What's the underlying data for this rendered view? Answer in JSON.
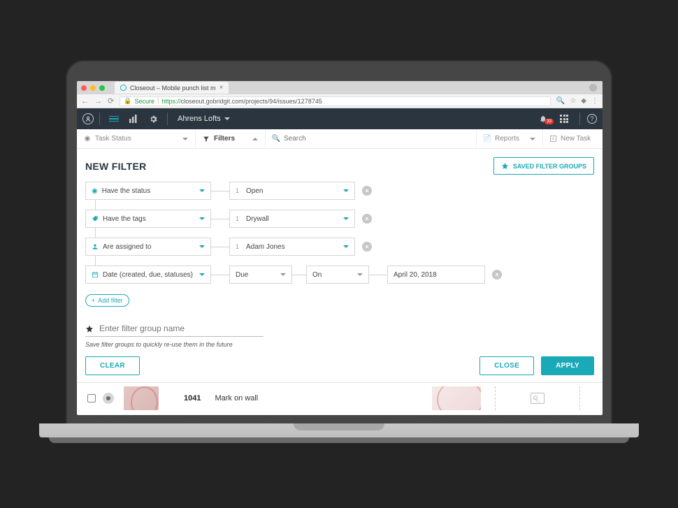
{
  "browser": {
    "tab_title": "Closeout – Mobile punch list m",
    "secure_label": "Secure",
    "url_proto": "https://",
    "url_rest": "closeout.gobridgit.com/projects/94/issues/1278745"
  },
  "header": {
    "project_name": "Ahrens Lofts",
    "notif_count": "33"
  },
  "toolbar": {
    "task_status": "Task Status",
    "filters": "Filters",
    "search_placeholder": "Search",
    "reports": "Reports",
    "new_task": "New Task"
  },
  "page": {
    "title": "NEW FILTER",
    "saved_groups": "SAVED FILTER GROUPS",
    "add_filter": "Add filter",
    "name_placeholder": "Enter filter group name",
    "hint": "Save filter groups to quickly re-use them in the future",
    "btn_clear": "CLEAR",
    "btn_close": "CLOSE",
    "btn_apply": "APPLY"
  },
  "filters": {
    "row1": {
      "label": "Have the status",
      "count": "1",
      "value": "Open"
    },
    "row2": {
      "label": "Have the tags",
      "count": "1",
      "value": "Drywall"
    },
    "row3": {
      "label": "Are assigned to",
      "count": "1",
      "value": "Adam Jones"
    },
    "row4": {
      "label": "Date (created, due, statuses)",
      "field": "Due",
      "op": "On",
      "date": "April 20, 2018"
    }
  },
  "result": {
    "id": "1041",
    "title": "Mark on wall"
  }
}
